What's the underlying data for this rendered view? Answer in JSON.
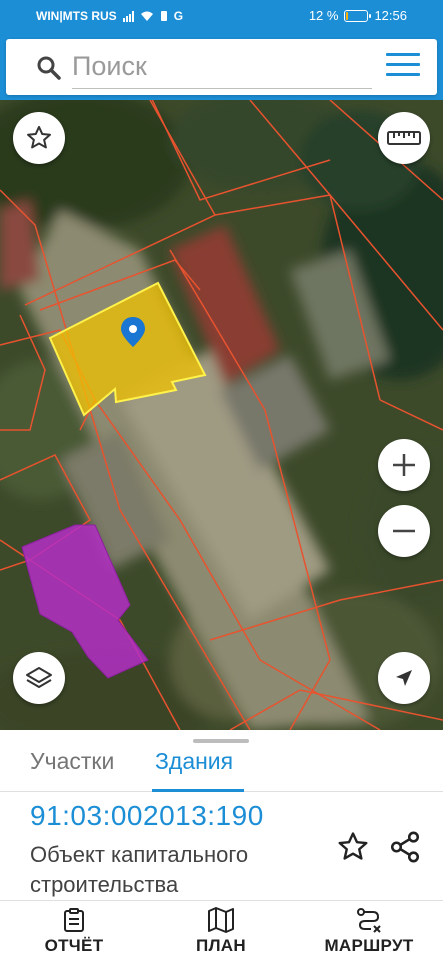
{
  "status_bar": {
    "carrier": "WIN|MTS RUS",
    "network_letter": "G",
    "battery_percent": "12 %",
    "battery_level": 0.12,
    "time": "12:56"
  },
  "search": {
    "placeholder": "Поиск"
  },
  "icons": {
    "search": "search-icon",
    "menu": "hamburger-menu-icon",
    "favorites": "star-outline-icon",
    "ruler": "ruler-icon",
    "zoom_in": "plus-icon",
    "zoom_out": "minus-icon",
    "layers": "layers-icon",
    "location": "navigation-arrow-icon",
    "marker": "map-pin-icon",
    "report": "clipboard-icon",
    "plan": "map-icon",
    "route": "route-icon",
    "share": "share-icon"
  },
  "colors": {
    "accent": "#1c8ed6",
    "parcel_border": "#e8532f",
    "selected_building": "#f2c200",
    "highlighted_building": "#b42ec6"
  },
  "panel": {
    "tabs": [
      "Участки",
      "Здания"
    ],
    "active_tab": "Здания",
    "cadastral_number": "91:03:002013:190",
    "object_type": "Объект капитального строительства"
  },
  "bottom_nav": {
    "report": "ОТЧЁТ",
    "plan": "ПЛАН",
    "route": "МАРШРУТ"
  }
}
